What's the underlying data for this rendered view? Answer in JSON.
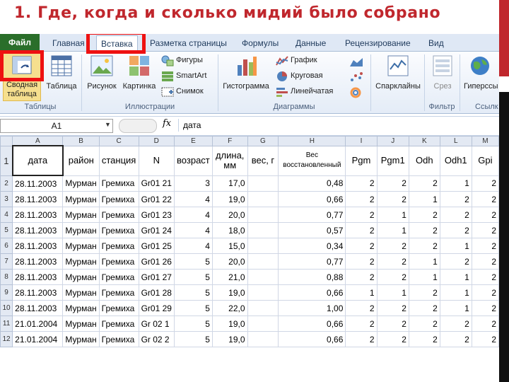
{
  "slide_title": "1. Где, когда и сколько мидий было собрано",
  "ribbon_tabs": [
    "Файл",
    "Главная",
    "Вставка",
    "Разметка страницы",
    "Формулы",
    "Данные",
    "Рецензирование",
    "Вид"
  ],
  "ribbon": {
    "pivot_table": "Сводная\nтаблица",
    "table": "Таблица",
    "group_tables": "Таблицы",
    "picture": "Рисунок",
    "clipart": "Картинка",
    "shapes": "Фигуры",
    "smartart": "SmartArt",
    "screenshot": "Снимок",
    "group_illustrations": "Иллюстрации",
    "histogram": "Гистограмма",
    "line_chart": "График",
    "pie_chart": "Круговая",
    "bar_chart": "Линейчатая",
    "group_charts": "Диаграммы",
    "sparklines": "Спарклайны",
    "slicer": "Срез",
    "group_filter": "Фильтр",
    "hyperlink": "Гиперссы",
    "group_links": "Ссылк"
  },
  "formula_bar": {
    "cell_ref": "A1",
    "fx": "fx",
    "value": "дата"
  },
  "columns": [
    "A",
    "B",
    "C",
    "D",
    "E",
    "F",
    "G",
    "H",
    "I",
    "J",
    "K",
    "L",
    "M"
  ],
  "header_row": [
    "дата",
    "район",
    "станция",
    "N",
    "возраст",
    "длина,\nмм",
    "вес, г",
    "Вес\nвосстановленный",
    "Pgm",
    "Pgm1",
    "Odh",
    "Odh1",
    "Gpi"
  ],
  "rows": [
    [
      "28.11.2003",
      "Мурман",
      "Гремиха",
      "Gr01 21",
      "3",
      "17,0",
      "",
      "0,48",
      "2",
      "2",
      "2",
      "1",
      "2"
    ],
    [
      "28.11.2003",
      "Мурман",
      "Гремиха",
      "Gr01 22",
      "4",
      "19,0",
      "",
      "0,66",
      "2",
      "2",
      "1",
      "2",
      "2"
    ],
    [
      "28.11.2003",
      "Мурман",
      "Гремиха",
      "Gr01 23",
      "4",
      "20,0",
      "",
      "0,77",
      "2",
      "1",
      "2",
      "2",
      "2"
    ],
    [
      "28.11.2003",
      "Мурман",
      "Гремиха",
      "Gr01 24",
      "4",
      "18,0",
      "",
      "0,57",
      "2",
      "1",
      "2",
      "2",
      "2"
    ],
    [
      "28.11.2003",
      "Мурман",
      "Гремиха",
      "Gr01 25",
      "4",
      "15,0",
      "",
      "0,34",
      "2",
      "2",
      "2",
      "1",
      "2"
    ],
    [
      "28.11.2003",
      "Мурман",
      "Гремиха",
      "Gr01 26",
      "5",
      "20,0",
      "",
      "0,77",
      "2",
      "2",
      "1",
      "2",
      "2"
    ],
    [
      "28.11.2003",
      "Мурман",
      "Гремиха",
      "Gr01 27",
      "5",
      "21,0",
      "",
      "0,88",
      "2",
      "2",
      "1",
      "1",
      "2"
    ],
    [
      "28.11.2003",
      "Мурман",
      "Гремиха",
      "Gr01 28",
      "5",
      "19,0",
      "",
      "0,66",
      "1",
      "1",
      "2",
      "1",
      "2"
    ],
    [
      "28.11.2003",
      "Мурман",
      "Гремиха",
      "Gr01 29",
      "5",
      "22,0",
      "",
      "1,00",
      "2",
      "2",
      "2",
      "1",
      "2"
    ],
    [
      "21.01.2004",
      "Мурман",
      "Гремиха",
      "Gr 02 1",
      "5",
      "19,0",
      "",
      "0,66",
      "2",
      "2",
      "2",
      "2",
      "2"
    ],
    [
      "21.01.2004",
      "Мурман",
      "Гремиха",
      "Gr 02 2",
      "5",
      "19,0",
      "",
      "0,66",
      "2",
      "2",
      "2",
      "2",
      "2"
    ]
  ],
  "colors": {
    "title": "#c0272d",
    "highlight": "#ee1111",
    "file_tab": "#2a6e2a"
  }
}
